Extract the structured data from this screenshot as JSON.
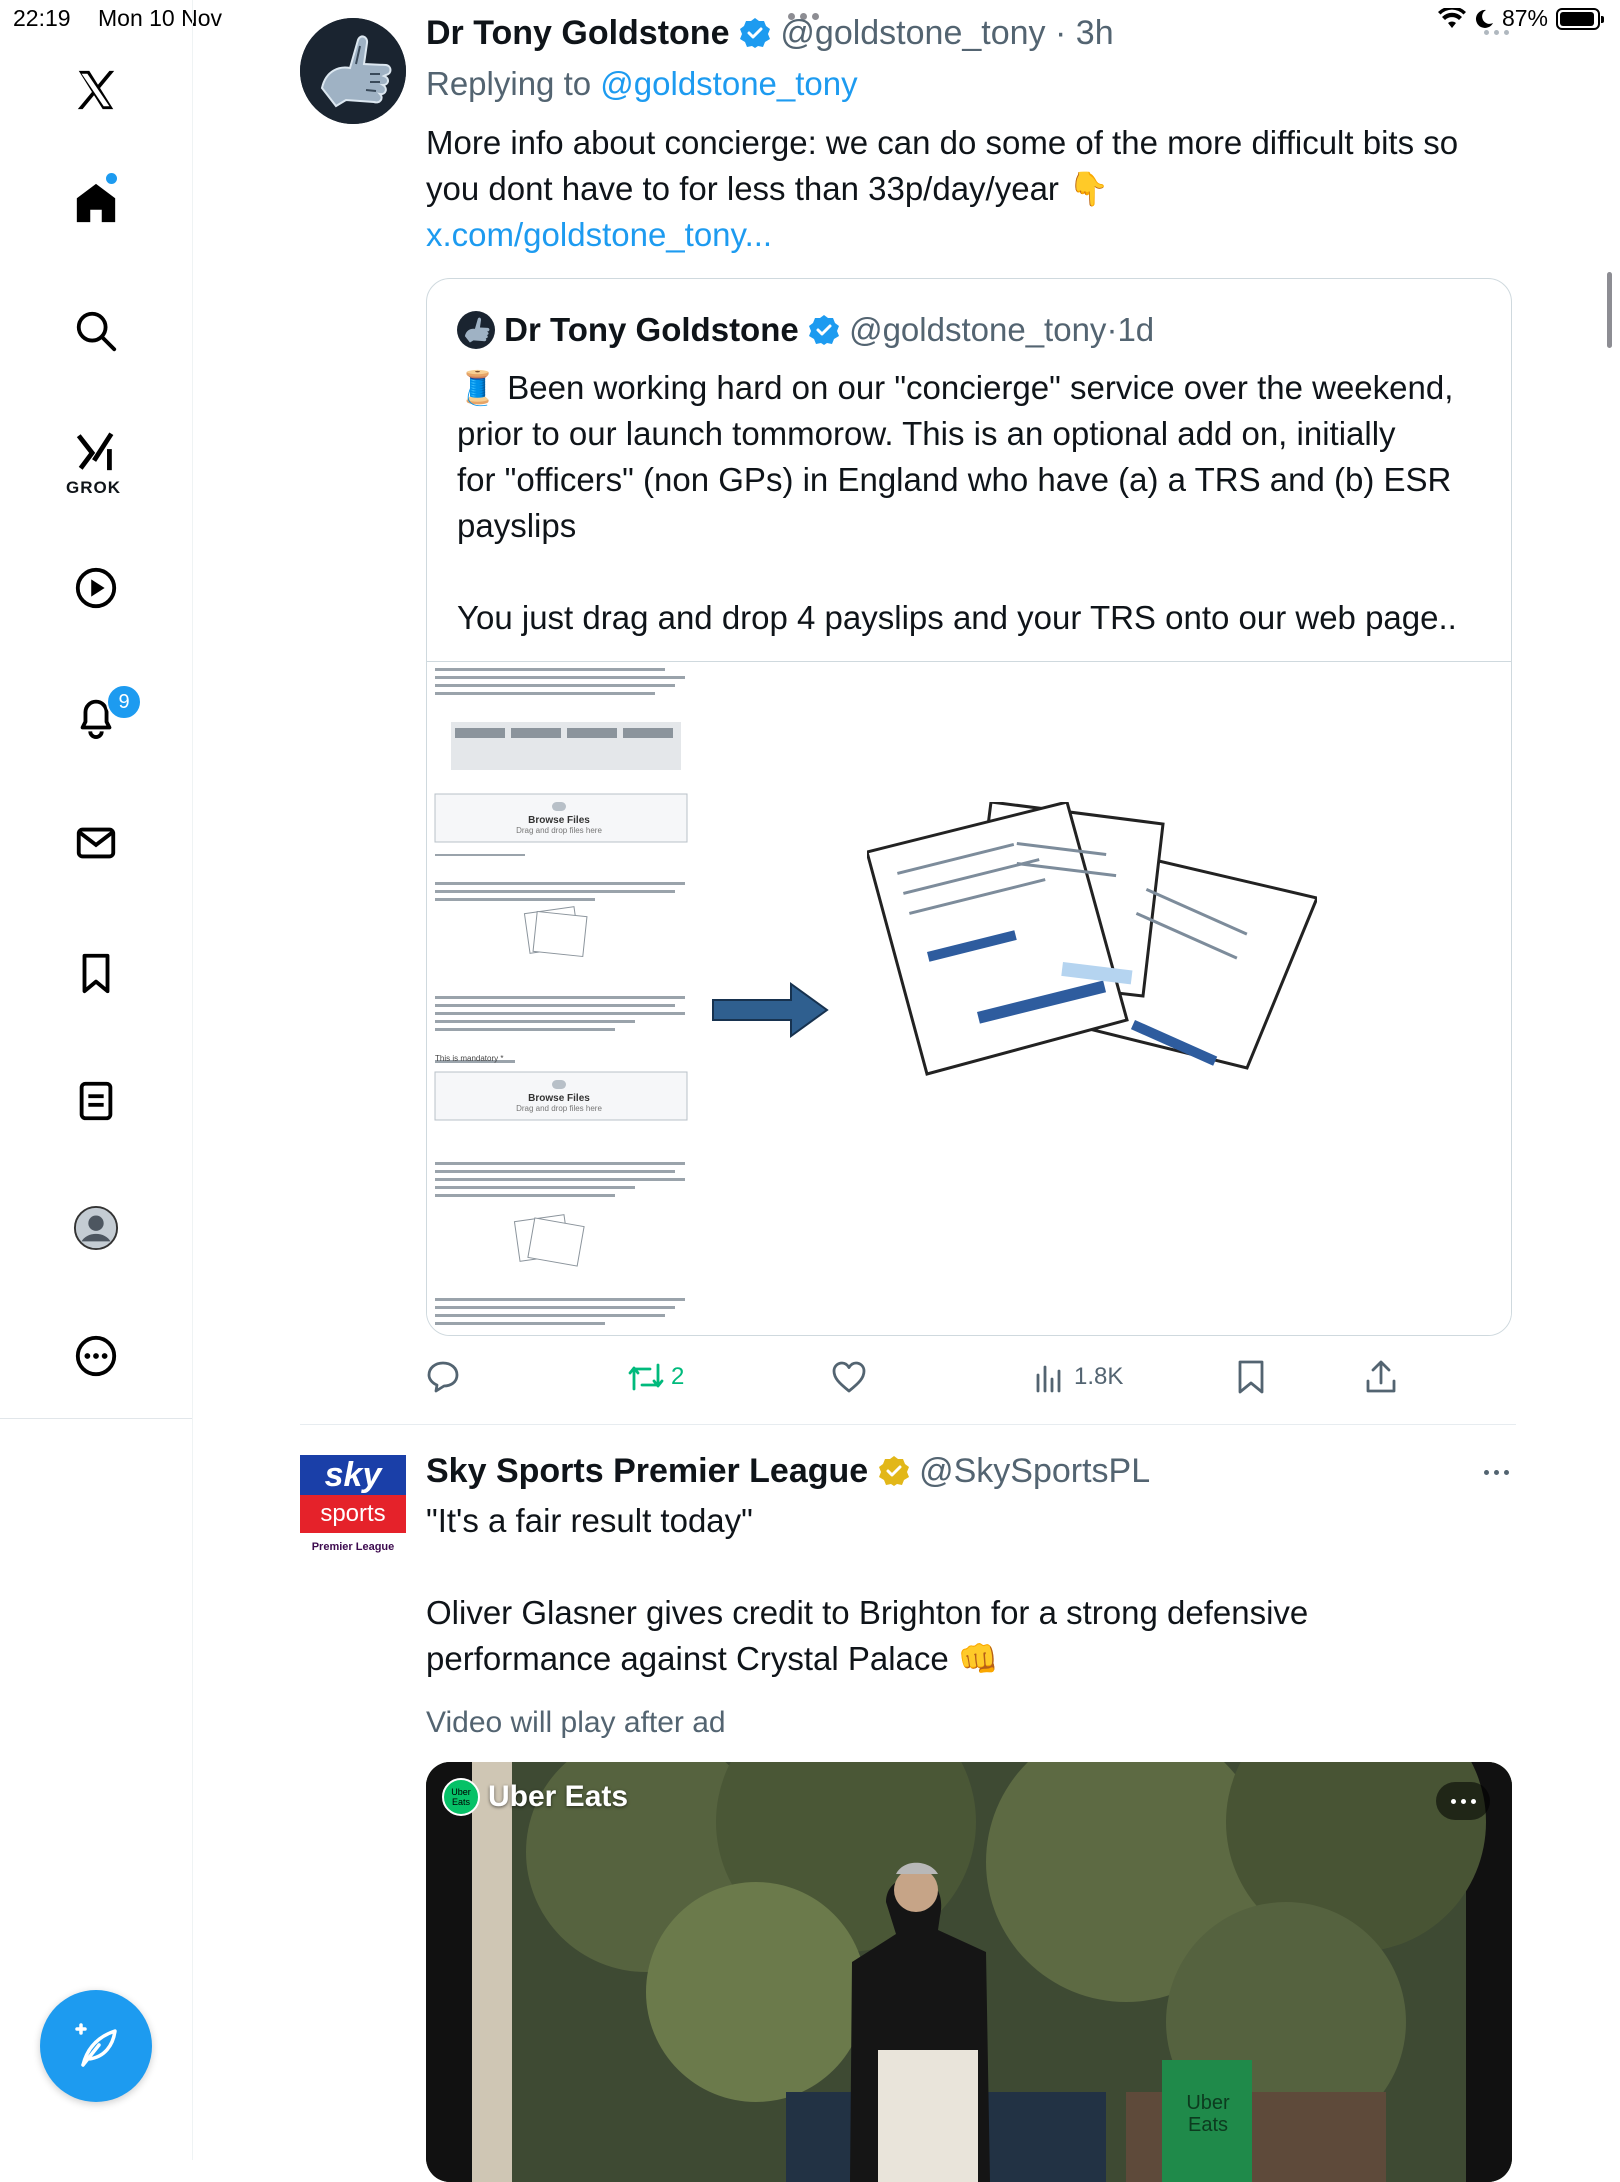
{
  "status_bar": {
    "time": "22:19",
    "date": "Mon 10 Nov",
    "battery": "87%"
  },
  "sidebar": {
    "grok_label": "GROK",
    "notifications_badge": "9"
  },
  "tweet1": {
    "name": "Dr Tony Goldstone",
    "handle": "@goldstone_tony",
    "sep": "·",
    "time": "3h",
    "replying_prefix": "Replying to",
    "replying_handle": "@goldstone_tony",
    "text_line1": "More info about concierge: we can do some of the more difficult bits so",
    "text_line2": "you dont have to for less than 33p/day/year 👇",
    "link": "x.com/goldstone_tony...",
    "quote": {
      "name": "Dr Tony Goldstone",
      "handle": "@goldstone_tony",
      "sep": "·",
      "time": "1d",
      "line1": "🧵 Been working hard on our \"concierge\" service over the weekend,",
      "line2": "prior to our launch tommorow. This is an optional add on, initially",
      "line3": "for \"officers\" (non GPs) in England who have (a) a TRS and (b) ESR",
      "line4": "payslips",
      "line5": "You just drag and drop 4 payslips and your TRS onto our web page..",
      "img": {
        "browse1": "Browse Files",
        "browse1_sub": "Drag and drop files here",
        "browse2": "Browse Files",
        "browse2_sub": "Drag and drop files here",
        "mandatory": "This is mandatory *"
      }
    },
    "actions": {
      "retweets": "2",
      "views": "1.8K"
    }
  },
  "tweet2": {
    "name": "Sky Sports Premier League",
    "handle": "@SkySportsPL",
    "avatar_line1": "sky",
    "avatar_line2": "sports",
    "avatar_line3": "Premier League",
    "quote_line": "\"It's a fair result today\"",
    "text_line1": "Oliver Glasner gives credit to Brighton for a strong defensive",
    "text_line2": "performance against Crystal Palace 👊",
    "video_note": "Video will play after ad",
    "ad_name": "Uber Eats",
    "ad_logo": "Uber Eats",
    "bag_text": "Uber Eats"
  },
  "colors": {
    "accent": "#1d9bf0",
    "retweet": "#00ba7c",
    "text": "#0f1419",
    "muted": "#536471"
  }
}
